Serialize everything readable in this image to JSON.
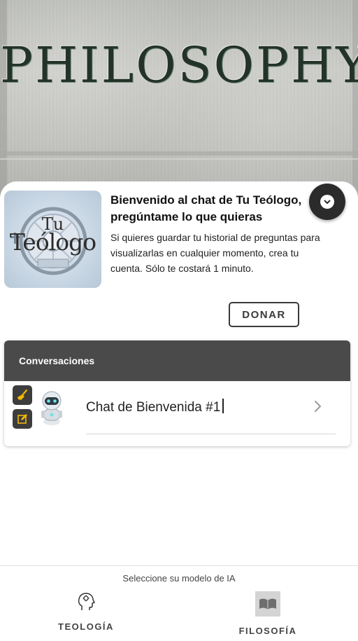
{
  "hero": {
    "engraved_word": "PHILOSOPHY"
  },
  "logo": {
    "line1": "Tu",
    "line2": "Teólogo"
  },
  "welcome": {
    "title": "Bienvenido al chat de Tu Teólogo, pregúntame lo que quieras",
    "body": "Si quieres guardar tu historial de preguntas para visualizarlas en cualquier momento, crea tu cuenta. Sólo te costará 1 minuto."
  },
  "donate_label": "DONAR",
  "conversations": {
    "header": "Conversaciones",
    "items": [
      {
        "title": "Chat de Bienvenida #1"
      }
    ]
  },
  "bottom": {
    "model_prompt": "Seleccione su modelo de IA",
    "tabs": [
      {
        "label": "TEOLOGÍA"
      },
      {
        "label": "FILOSOFÍA"
      }
    ]
  },
  "colors": {
    "dark": "#4a4a4a",
    "accent_yellow": "#f2b705"
  },
  "icons": {
    "collapse": "chevron-down-icon",
    "clear": "broom-icon",
    "edit": "edit-icon",
    "avatar": "robot-avatar-icon",
    "open": "chevron-right-icon",
    "theology": "head-gear-icon",
    "philosophy": "open-book-icon"
  }
}
